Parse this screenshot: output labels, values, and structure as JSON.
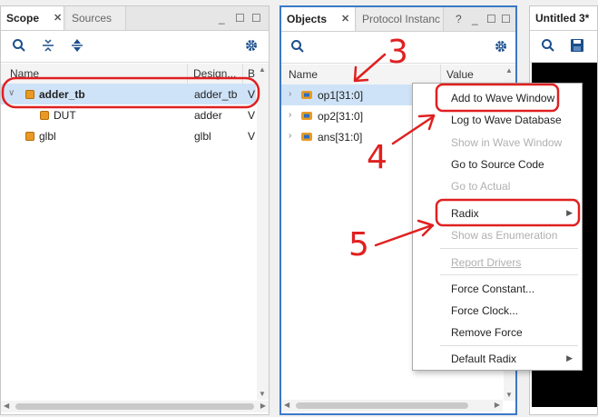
{
  "scope_panel": {
    "tabs": [
      {
        "label": "Scope",
        "active": true
      },
      {
        "label": "Sources",
        "active": false
      }
    ],
    "columns": [
      "Name",
      "Design...",
      "B"
    ],
    "rows": [
      {
        "name": "adder_tb",
        "design": "adder_tb",
        "b": "V",
        "expanded": true,
        "selected": true,
        "level": 0
      },
      {
        "name": "DUT",
        "design": "adder",
        "b": "V",
        "level": 1
      },
      {
        "name": "glbl",
        "design": "glbl",
        "b": "V",
        "level": 0
      }
    ]
  },
  "objects_panel": {
    "tabs": [
      {
        "label": "Objects",
        "active": true
      },
      {
        "label": "Protocol Instanc",
        "active": false
      }
    ],
    "help_glyph": "?",
    "columns": [
      "Name",
      "Value"
    ],
    "rows": [
      {
        "name": "op1[31:0]",
        "selected": true
      },
      {
        "name": "op2[31:0]"
      },
      {
        "name": "ans[31:0]"
      }
    ]
  },
  "wave_panel": {
    "tab": "Untitled 3*"
  },
  "context_menu": {
    "items": [
      {
        "label": "Add to Wave Window",
        "enabled": true,
        "highlighted": true
      },
      {
        "label": "Log to Wave Database",
        "enabled": true
      },
      {
        "label": "Show in Wave Window",
        "enabled": false
      },
      {
        "label": "Go to Source Code",
        "enabled": true
      },
      {
        "label": "Go to Actual",
        "enabled": false
      },
      {
        "label": "Radix",
        "enabled": true,
        "submenu": true,
        "highlighted": true
      },
      {
        "label": "Show as Enumeration",
        "enabled": false
      },
      {
        "label": "Report Drivers",
        "enabled": false
      },
      {
        "label": "Force Constant...",
        "enabled": true
      },
      {
        "label": "Force Clock...",
        "enabled": true
      },
      {
        "label": "Remove Force",
        "enabled": true
      },
      {
        "label": "Default Radix",
        "enabled": true,
        "submenu": true
      }
    ]
  },
  "annotations": {
    "step3": "3",
    "step4": "4",
    "step5": "5",
    "color": "#e02020"
  },
  "colors": {
    "selection": "#cfe3f8",
    "objects_border": "#3b78c6",
    "annotation": "#e02020"
  }
}
